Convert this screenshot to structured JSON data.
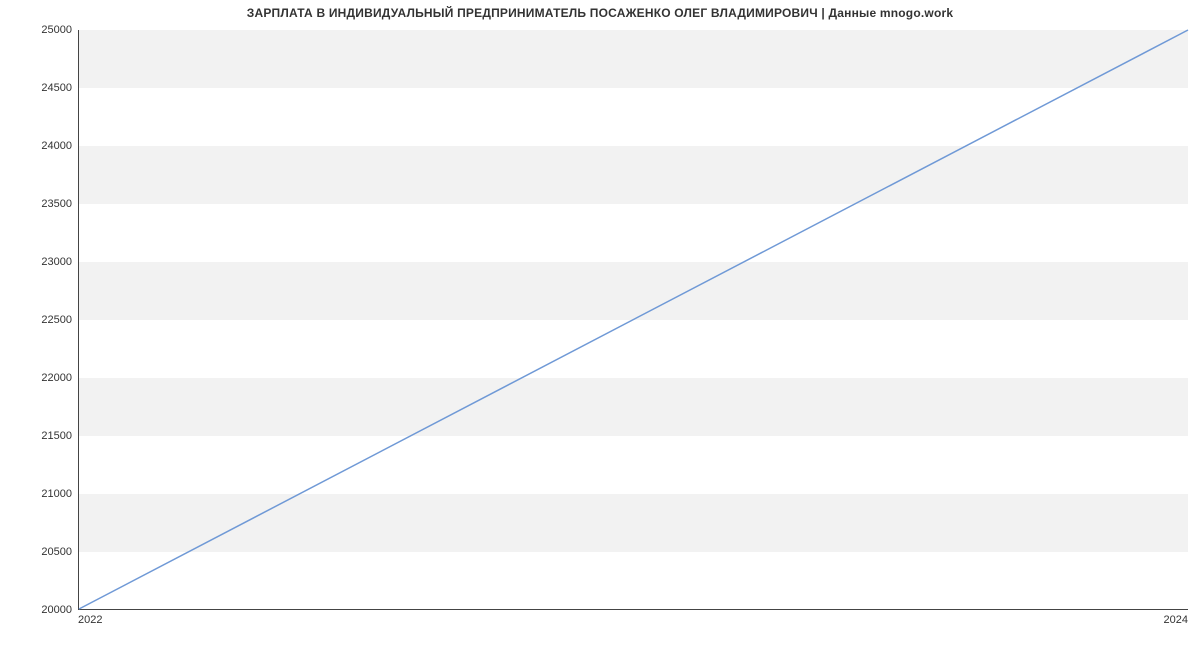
{
  "title": "ЗАРПЛАТА В ИНДИВИДУАЛЬНЫЙ ПРЕДПРИНИМАТЕЛЬ ПОСАЖЕНКО ОЛЕГ ВЛАДИМИРОВИЧ | Данные mnogo.work",
  "chart_data": {
    "type": "line",
    "title": "ЗАРПЛАТА В ИНДИВИДУАЛЬНЫЙ ПРЕДПРИНИМАТЕЛЬ ПОСАЖЕНКО ОЛЕГ ВЛАДИМИРОВИЧ | Данные mnogo.work",
    "xlabel": "",
    "ylabel": "",
    "x": [
      2022,
      2024
    ],
    "values": [
      20000,
      25000
    ],
    "xlim": [
      2022,
      2024
    ],
    "ylim": [
      20000,
      25000
    ],
    "yticks": [
      20000,
      20500,
      21000,
      21500,
      22000,
      22500,
      23000,
      23500,
      24000,
      24500,
      25000
    ],
    "xticks": [
      2022,
      2024
    ],
    "line_color": "#6f99d6",
    "band_color": "#f2f2f2"
  }
}
